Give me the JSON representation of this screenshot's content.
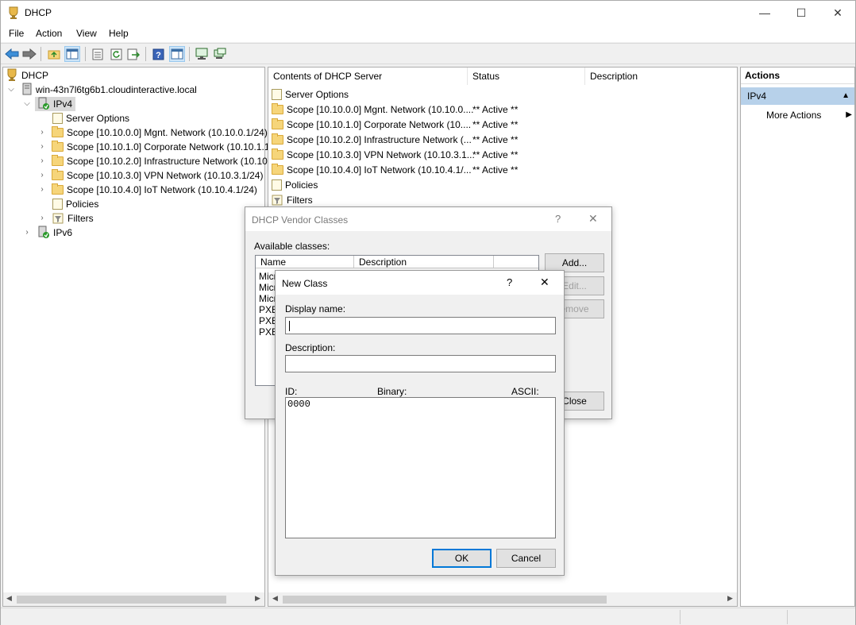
{
  "window": {
    "title": "DHCP",
    "controls": {
      "minimize": "—",
      "maximize": "☐",
      "close": "✕"
    }
  },
  "menu": [
    "File",
    "Action",
    "View",
    "Help"
  ],
  "tree": {
    "root": "DHCP",
    "server": "win-43n7l6tg6b1.cloudinteractive.local",
    "ipv4": "IPv4",
    "server_options": "Server Options",
    "scopes": [
      "Scope [10.10.0.0] Mgnt. Network (10.10.0.1/24)",
      "Scope [10.10.1.0] Corporate Network (10.10.1.1/",
      "Scope [10.10.2.0] Infrastructure Network (10.10.",
      "Scope [10.10.3.0] VPN Network (10.10.3.1/24)",
      "Scope [10.10.4.0] IoT Network (10.10.4.1/24)"
    ],
    "policies": "Policies",
    "filters": "Filters",
    "ipv6": "IPv6"
  },
  "list": {
    "columns": [
      "Contents of DHCP Server",
      "Status",
      "Description"
    ],
    "rows": [
      {
        "name": "Server Options",
        "status": ""
      },
      {
        "name": "Scope [10.10.0.0] Mgnt. Network (10.10.0....",
        "status": "** Active **"
      },
      {
        "name": "Scope [10.10.1.0] Corporate Network (10....",
        "status": "** Active **"
      },
      {
        "name": "Scope [10.10.2.0] Infrastructure Network (...",
        "status": "** Active **"
      },
      {
        "name": "Scope [10.10.3.0] VPN Network (10.10.3.1...",
        "status": "** Active **"
      },
      {
        "name": "Scope [10.10.4.0] IoT Network (10.10.4.1/...",
        "status": "** Active **"
      },
      {
        "name": "Policies",
        "status": ""
      },
      {
        "name": "Filters",
        "status": ""
      }
    ]
  },
  "actions": {
    "title": "Actions",
    "section": "IPv4",
    "more": "More Actions"
  },
  "vendor_dialog": {
    "title": "DHCP Vendor Classes",
    "help": "?",
    "close": "✕",
    "available_label": "Available classes:",
    "columns": [
      "Name",
      "Description"
    ],
    "rows": [
      "Micr",
      "Micr",
      "Micr",
      "PXE",
      "PXE",
      "PXE"
    ],
    "add": "Add...",
    "edit": "Edit...",
    "remove": "emove",
    "close_btn": "Close"
  },
  "new_class": {
    "title": "New Class",
    "help": "?",
    "close": "✕",
    "display_name_label": "Display name:",
    "display_name_value": "",
    "description_label": "Description:",
    "description_value": "",
    "id_label": "ID:",
    "binary_label": "Binary:",
    "ascii_label": "ASCII:",
    "id_value": "0000",
    "ok": "OK",
    "cancel": "Cancel"
  }
}
